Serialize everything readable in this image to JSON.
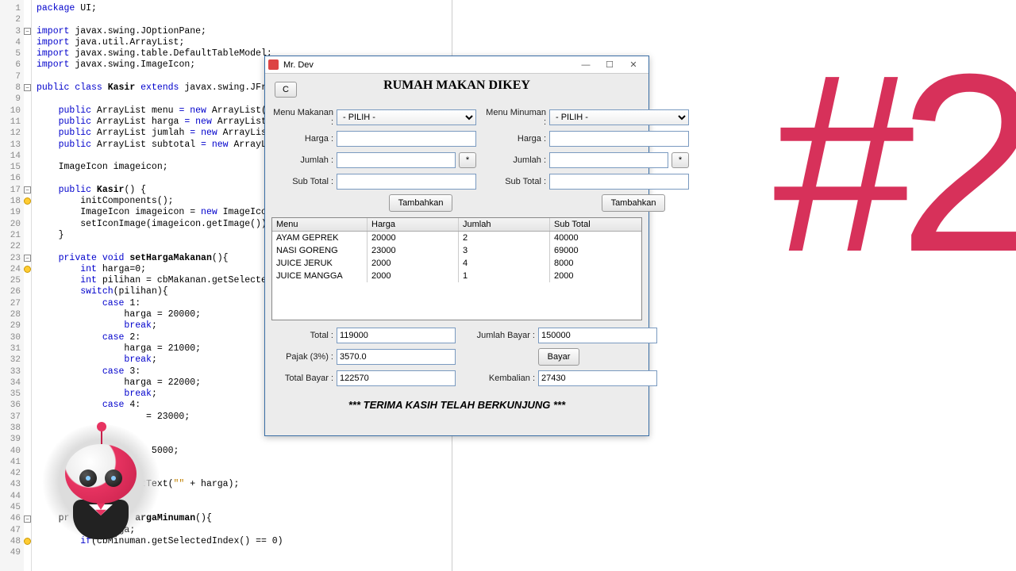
{
  "code": {
    "line_start": 1,
    "line_end": 49,
    "fold_markers": [
      3,
      8,
      17,
      23,
      46
    ],
    "lightbulbs": [
      18,
      24,
      48
    ],
    "lines": [
      {
        "t": "package",
        "rest": " UI;"
      },
      {
        "raw": ""
      },
      {
        "t": "import",
        "rest": " javax.swing.JOptionPane;"
      },
      {
        "t": "import",
        "rest": " java.util.ArrayList;"
      },
      {
        "t": "import",
        "rest": " javax.swing.table.DefaultTableModel;"
      },
      {
        "t": "import",
        "rest": " javax.swing.ImageIcon;"
      },
      {
        "raw": ""
      },
      {
        "seg": [
          [
            "kw",
            "public class "
          ],
          [
            "fn",
            "Kasir"
          ],
          [
            "kw",
            " extends "
          ],
          [
            "",
            "javax.swing.JFram"
          ]
        ]
      },
      {
        "raw": ""
      },
      {
        "seg": [
          [
            "",
            "    "
          ],
          [
            "kw",
            "public "
          ],
          [
            "",
            "ArrayList "
          ],
          [
            "cls",
            "menu"
          ],
          [
            "kw",
            " = new "
          ],
          [
            "",
            "ArrayList();"
          ]
        ]
      },
      {
        "seg": [
          [
            "",
            "    "
          ],
          [
            "kw",
            "public "
          ],
          [
            "",
            "ArrayList "
          ],
          [
            "cls",
            "harga"
          ],
          [
            "kw",
            " = new "
          ],
          [
            "",
            "ArrayList()"
          ]
        ]
      },
      {
        "seg": [
          [
            "",
            "    "
          ],
          [
            "kw",
            "public "
          ],
          [
            "",
            "ArrayList "
          ],
          [
            "cls",
            "jumlah"
          ],
          [
            "kw",
            " = new "
          ],
          [
            "",
            "ArrayList("
          ]
        ]
      },
      {
        "seg": [
          [
            "",
            "    "
          ],
          [
            "kw",
            "public "
          ],
          [
            "",
            "ArrayList "
          ],
          [
            "cls",
            "subtotal"
          ],
          [
            "kw",
            " = new "
          ],
          [
            "",
            "ArrayLis"
          ]
        ]
      },
      {
        "raw": ""
      },
      {
        "seg": [
          [
            "",
            "    ImageIcon "
          ],
          [
            "cls",
            "imageicon"
          ],
          [
            "",
            ";"
          ]
        ]
      },
      {
        "raw": ""
      },
      {
        "seg": [
          [
            "",
            "    "
          ],
          [
            "kw",
            "public "
          ],
          [
            "fn",
            "Kasir"
          ],
          [
            "",
            "() {"
          ]
        ]
      },
      {
        "raw": "        initComponents();"
      },
      {
        "seg": [
          [
            "",
            "        ImageIcon imageicon = "
          ],
          [
            "kw",
            "new "
          ],
          [
            "",
            "ImageIcon("
          ]
        ]
      },
      {
        "raw": "        setIconImage(imageicon.getImage());"
      },
      {
        "raw": "    }"
      },
      {
        "raw": ""
      },
      {
        "seg": [
          [
            "",
            "    "
          ],
          [
            "kw",
            "private void "
          ],
          [
            "fn",
            "setHargaMakanan"
          ],
          [
            "",
            "(){"
          ]
        ]
      },
      {
        "seg": [
          [
            "",
            "        "
          ],
          [
            "kw",
            "int "
          ],
          [
            "",
            "harga=0;"
          ]
        ]
      },
      {
        "seg": [
          [
            "",
            "        "
          ],
          [
            "kw",
            "int "
          ],
          [
            "",
            "pilihan = cbMakanan.getSelectedI"
          ]
        ]
      },
      {
        "seg": [
          [
            "",
            "        "
          ],
          [
            "kw",
            "switch"
          ],
          [
            "",
            "(pilihan){"
          ]
        ]
      },
      {
        "seg": [
          [
            "",
            "            "
          ],
          [
            "kw",
            "case "
          ],
          [
            "",
            "1:"
          ]
        ]
      },
      {
        "raw": "                harga = 20000;"
      },
      {
        "seg": [
          [
            "",
            "                "
          ],
          [
            "kw",
            "break"
          ],
          [
            "",
            ";"
          ]
        ]
      },
      {
        "seg": [
          [
            "",
            "            "
          ],
          [
            "kw",
            "case "
          ],
          [
            "",
            "2:"
          ]
        ]
      },
      {
        "raw": "                harga = 21000;"
      },
      {
        "seg": [
          [
            "",
            "                "
          ],
          [
            "kw",
            "break"
          ],
          [
            "",
            ";"
          ]
        ]
      },
      {
        "seg": [
          [
            "",
            "            "
          ],
          [
            "kw",
            "case "
          ],
          [
            "",
            "3:"
          ]
        ]
      },
      {
        "raw": "                harga = 22000;"
      },
      {
        "seg": [
          [
            "",
            "                "
          ],
          [
            "kw",
            "break"
          ],
          [
            "",
            ";"
          ]
        ]
      },
      {
        "seg": [
          [
            "",
            "            "
          ],
          [
            "kw",
            "case "
          ],
          [
            "",
            "4:"
          ]
        ]
      },
      {
        "raw": "                    = 23000;"
      },
      {
        "raw": ""
      },
      {
        "raw": ""
      },
      {
        "raw": "                     5000;"
      },
      {
        "raw": ""
      },
      {
        "raw": ""
      },
      {
        "seg": [
          [
            "",
            "                  etText("
          ],
          [
            "str",
            "\"\" "
          ],
          [
            "",
            "+ harga);"
          ]
        ]
      },
      {
        "raw": ""
      },
      {
        "raw": ""
      },
      {
        "seg": [
          [
            "",
            "    pr            "
          ],
          [
            "fn",
            "argaMinuman"
          ],
          [
            "",
            "(){"
          ]
        ]
      },
      {
        "seg": [
          [
            "",
            "        "
          ],
          [
            "kw",
            "int "
          ],
          [
            "",
            "harga;"
          ]
        ]
      },
      {
        "seg": [
          [
            "",
            "        "
          ],
          [
            "kw",
            "if"
          ],
          [
            "",
            "(cbMinuman.getSelectedIndex() == 0)"
          ]
        ]
      },
      {
        "raw": ""
      }
    ]
  },
  "swing": {
    "title": "Mr. Dev",
    "app_title": "RUMAH MAKAN DIKEY",
    "c_btn": "C",
    "col_left": {
      "menu_label": "Menu Makanan :",
      "menu_value": "- PILIH -",
      "harga_label": "Harga :",
      "harga_value": "",
      "jumlah_label": "Jumlah :",
      "jumlah_value": "",
      "star": "*",
      "subtotal_label": "Sub Total :",
      "subtotal_value": "",
      "add_btn": "Tambahkan"
    },
    "col_right": {
      "menu_label": "Menu Minuman :",
      "menu_value": "- PILIH -",
      "harga_label": "Harga :",
      "harga_value": "",
      "jumlah_label": "Jumlah :",
      "jumlah_value": "",
      "star": "*",
      "subtotal_label": "Sub Total :",
      "subtotal_value": "",
      "add_btn": "Tambahkan"
    },
    "table": {
      "headers": [
        "Menu",
        "Harga",
        "Jumlah",
        "Sub Total"
      ],
      "rows": [
        [
          "AYAM GEPREK",
          "20000",
          "2",
          "40000"
        ],
        [
          "NASI GORENG",
          "23000",
          "3",
          "69000"
        ],
        [
          "JUICE JERUK",
          "2000",
          "4",
          "8000"
        ],
        [
          "JUICE MANGGA",
          "2000",
          "1",
          "2000"
        ]
      ]
    },
    "bottom": {
      "total_label": "Total :",
      "total_value": "119000",
      "pajak_label": "Pajak (3%) :",
      "pajak_value": "3570.0",
      "totalbayar_label": "Total Bayar :",
      "totalbayar_value": "122570",
      "jmlbayar_label": "Jumlah Bayar :",
      "jmlbayar_value": "150000",
      "bayar_btn": "Bayar",
      "kembalian_label": "Kembalian :",
      "kembalian_value": "27430"
    },
    "thanks": "*** TERIMA KASIH TELAH BERKUNJUNG ***"
  },
  "big2": "#2"
}
